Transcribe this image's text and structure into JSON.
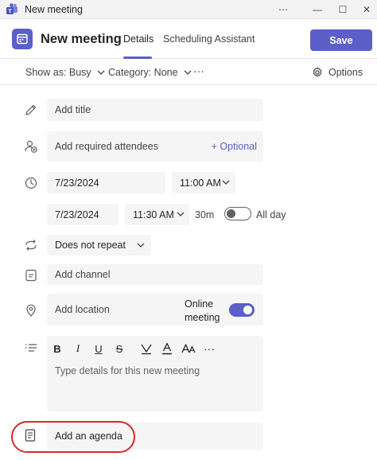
{
  "window": {
    "title": "New meeting",
    "controls": [
      "⋯",
      "—",
      "☐",
      "✕"
    ]
  },
  "header": {
    "title": "New meeting",
    "tabs": [
      {
        "label": "Details",
        "active": true
      },
      {
        "label": "Scheduling Assistant",
        "active": false
      }
    ],
    "save_label": "Save",
    "accent_color": "#5b5fc7"
  },
  "toolbar": {
    "show_as": "Show as: Busy",
    "category": "Category: None",
    "more": "···",
    "options": "Options"
  },
  "form": {
    "title_placeholder": "Add title",
    "attendees_placeholder": "Add required attendees",
    "optional_link": "+ Optional",
    "start_date": "7/23/2024",
    "start_time": "11:00 AM",
    "end_date": "7/23/2024",
    "end_time": "11:30 AM",
    "duration": "30m",
    "all_day_label": "All day",
    "all_day_on": false,
    "repeat": "Does not repeat",
    "channel_placeholder": "Add channel",
    "location_placeholder": "Add location",
    "online_meeting_line1": "Online",
    "online_meeting_line2": "meeting",
    "online_meeting_on": true,
    "details_placeholder": "Type details for this new meeting",
    "agenda_label": "Add an agenda"
  },
  "formatting": {
    "bold": "B",
    "italic": "I",
    "underline": "U",
    "strike": "S",
    "more": "···"
  }
}
